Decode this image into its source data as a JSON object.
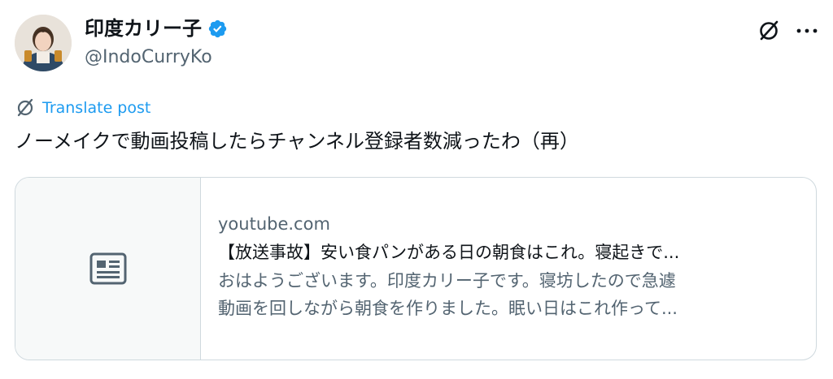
{
  "author": {
    "display_name": "印度カリー子",
    "handle": "@IndoCurryKo",
    "verified": true,
    "avatar_icon": "avatar-photo"
  },
  "actions": {
    "grok_icon": "grok-icon",
    "more_icon": "more-icon"
  },
  "translate": {
    "label": "Translate post",
    "icon": "translate-icon"
  },
  "post": {
    "text": "ノーメイクで動画投稿したらチャンネル登録者数減ったわ（再）"
  },
  "link_card": {
    "thumbnail_icon": "article-icon",
    "domain": "youtube.com",
    "title": "【放送事故】安い食パンがある日の朝食はこれ。寝起きで...",
    "description_line1": "おはようございます。印度カリー子です。寝坊したので急遽",
    "description_line2": "動画を回しながら朝食を作りました。眠い日はこれ作って..."
  },
  "colors": {
    "text_primary": "#0f1419",
    "text_secondary": "#536471",
    "accent": "#1d9bf0",
    "border": "#cfd9de"
  }
}
